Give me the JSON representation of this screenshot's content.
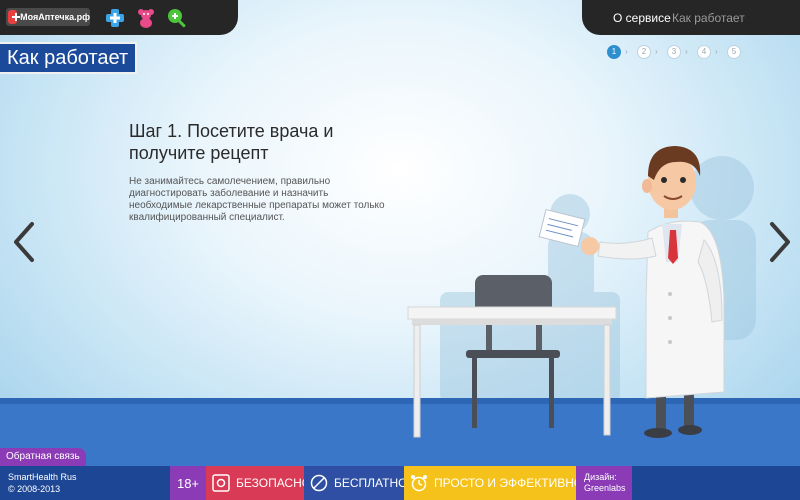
{
  "app": {
    "logo_text": "МояАптечка.рф"
  },
  "toolbar": {
    "icons": [
      "plus-icon",
      "teddy-bear-icon",
      "search-zoom-icon"
    ]
  },
  "nav": {
    "about": "О сервисе",
    "how_it_works": "Как работает"
  },
  "page": {
    "title": "Как работает"
  },
  "steps": {
    "items": [
      "1",
      "2",
      "3",
      "4",
      "5"
    ],
    "active": "1"
  },
  "content": {
    "heading": "Шаг 1. Посетите врача и получите рецепт",
    "description": "Не занимайтесь самолечением, правильно диагностировать заболевание и назначить необходимые лекарственные препараты может только квалифицированный специалист."
  },
  "footer": {
    "feedback": "Обратная связь",
    "company": "SmartHealth Rus",
    "copyright": "© 2008-2013",
    "age": "18+",
    "safe": "БЕЗОПАСНО",
    "free": "БЕСПЛАТНО",
    "easy": "ПРОСТО И ЭФФЕКТИВНО",
    "design_label": "Дизайн:",
    "design_by": "Greenlabs"
  },
  "colors": {
    "accent": "#1c4a9a",
    "floor": "#3a77c9",
    "purple": "#8a3bb5",
    "red": "#d93a55",
    "yellow": "#f5c21b"
  }
}
